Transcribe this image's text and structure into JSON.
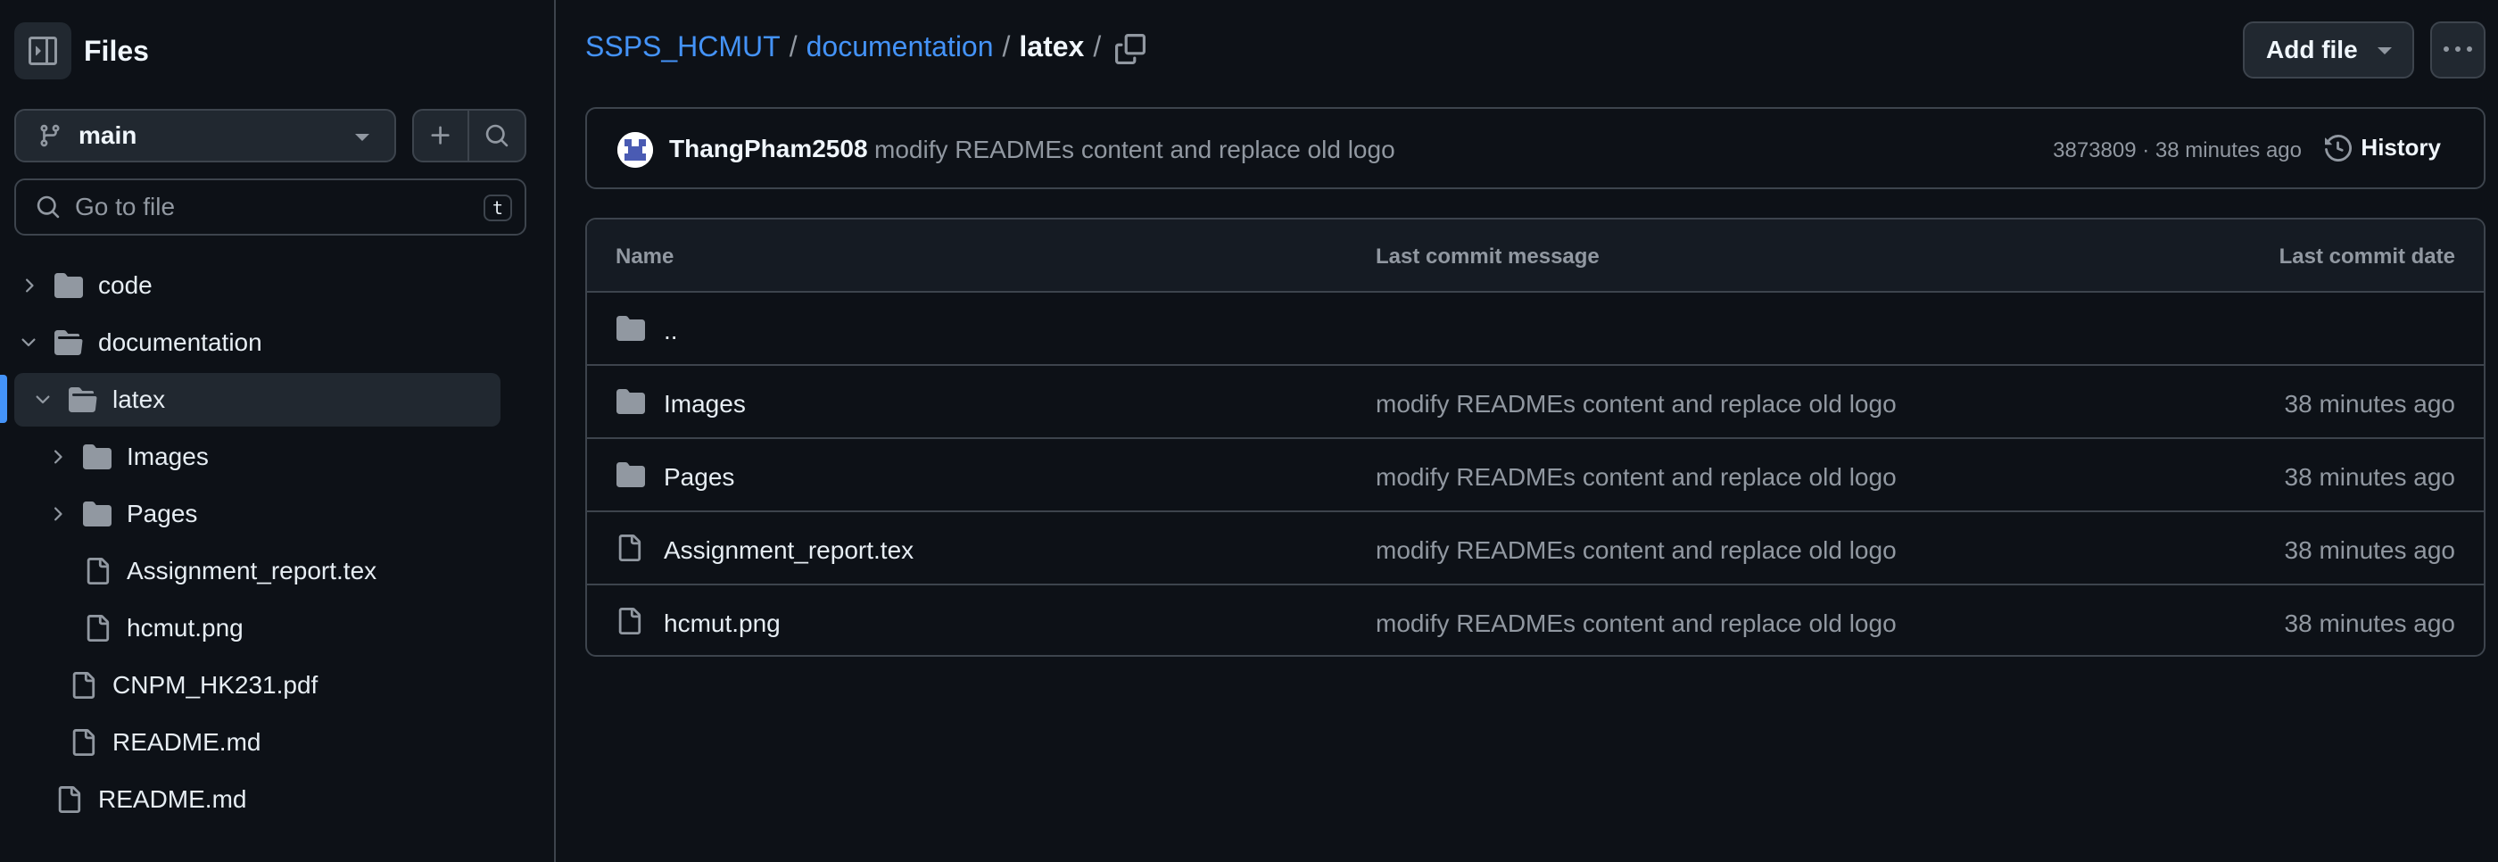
{
  "sidebar": {
    "title": "Files",
    "branch": "main",
    "search_placeholder": "Go to file",
    "search_shortcut": "t",
    "tree": [
      {
        "label": "code",
        "type": "folder",
        "expanded": false
      },
      {
        "label": "documentation",
        "type": "folder",
        "expanded": true
      },
      {
        "label": "latex",
        "type": "folder",
        "expanded": true,
        "active": true
      },
      {
        "label": "Images",
        "type": "folder",
        "expanded": false
      },
      {
        "label": "Pages",
        "type": "folder",
        "expanded": false
      },
      {
        "label": "Assignment_report.tex",
        "type": "file"
      },
      {
        "label": "hcmut.png",
        "type": "file"
      },
      {
        "label": "CNPM_HK231.pdf",
        "type": "file"
      },
      {
        "label": "README.md",
        "type": "file"
      },
      {
        "label": "README.md",
        "type": "file"
      }
    ]
  },
  "breadcrumb": {
    "repo": "SSPS_HCMUT",
    "folder": "documentation",
    "current": "latex",
    "separator": "/"
  },
  "header": {
    "add_file_label": "Add file"
  },
  "commit": {
    "author": "ThangPham2508",
    "message": "modify READMEs content and replace old logo",
    "meta": "3873809 · 38 minutes ago",
    "history_label": "History"
  },
  "table": {
    "headers": {
      "name": "Name",
      "message": "Last commit message",
      "date": "Last commit date"
    },
    "parent": "..",
    "rows": [
      {
        "name": "Images",
        "type": "folder",
        "message": "modify READMEs content and replace old logo",
        "date": "38 minutes ago"
      },
      {
        "name": "Pages",
        "type": "folder",
        "message": "modify READMEs content and replace old logo",
        "date": "38 minutes ago"
      },
      {
        "name": "Assignment_report.tex",
        "type": "file",
        "message": "modify READMEs content and replace old logo",
        "date": "38 minutes ago"
      },
      {
        "name": "hcmut.png",
        "type": "file",
        "message": "modify READMEs content and replace old logo",
        "date": "38 minutes ago"
      }
    ]
  },
  "colors": {
    "background": "#0d1117",
    "border": "#3d444d",
    "link": "#4493f8",
    "muted": "#9198a1",
    "button": "#212830"
  }
}
